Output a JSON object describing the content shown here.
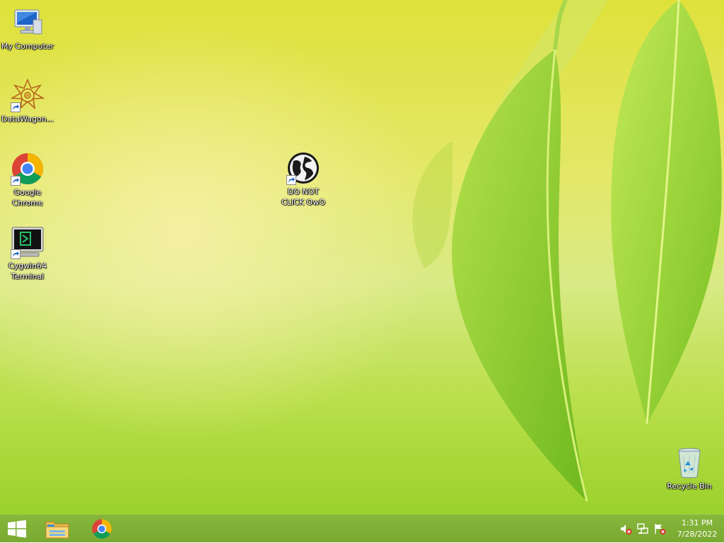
{
  "desktop": {
    "icons": [
      {
        "label": "My Computer",
        "icon": "computer-icon"
      },
      {
        "label": "DataWagon...",
        "icon": "datawagon-icon"
      },
      {
        "label": "Google Chrome",
        "icon": "chrome-icon"
      },
      {
        "label": "Cygwin64 Terminal",
        "icon": "terminal-icon"
      },
      {
        "label": "DO NOT CLICK OwO",
        "icon": "globe-icon"
      },
      {
        "label": "Recycle Bin",
        "icon": "recycle-bin-icon"
      }
    ]
  },
  "taskbar": {
    "start": "start-icon",
    "pinned": [
      "file-explorer-icon",
      "chrome-icon"
    ],
    "tray": [
      "volume-muted-icon",
      "network-icon",
      "action-center-flag-icon"
    ],
    "clock": {
      "time": "1:31 PM",
      "date": "7/28/2022"
    }
  },
  "colors": {
    "taskbar": "#7fae36",
    "wallpaper_top": "#dfe13a",
    "wallpaper_bottom": "#9bd12c",
    "leaf": "#8ccf2c"
  }
}
